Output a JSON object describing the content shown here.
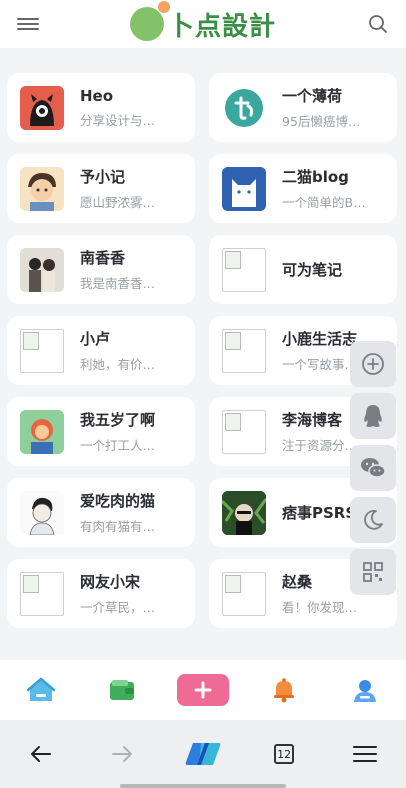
{
  "header": {
    "logo_text": "卜点設計",
    "menu_icon": "hamburger-icon",
    "search_icon": "search-icon"
  },
  "cards": [
    {
      "title": "Heo",
      "desc": "分享设计与…",
      "avatar": "red-monster"
    },
    {
      "title": "一个薄荷",
      "desc": "95后懒癌博…",
      "avatar": "teal-letter"
    },
    {
      "title": "予小记",
      "desc": "愿山野浓雾…",
      "avatar": "cartoon-boy"
    },
    {
      "title": "二猫blog",
      "desc": "一个简单的B…",
      "avatar": "blue-cat"
    },
    {
      "title": "南香香",
      "desc": "我是南香香…",
      "avatar": "photo-couple"
    },
    {
      "title": "可为笔记",
      "desc": "",
      "avatar": "broken"
    },
    {
      "title": "小卢",
      "desc": "利她，有价…",
      "avatar": "broken"
    },
    {
      "title": "小鹿生活志",
      "desc": "一个写故事…",
      "avatar": "broken"
    },
    {
      "title": "我五岁了啊",
      "desc": "一个打工人…",
      "avatar": "colorful-kid"
    },
    {
      "title": "李海博客",
      "desc": "注于资源分…",
      "avatar": "broken"
    },
    {
      "title": "爱吃肉的猫",
      "desc": "有肉有猫有…",
      "avatar": "sketch-boy"
    },
    {
      "title": "痞事PSRS",
      "desc": "",
      "avatar": "dog-plants"
    },
    {
      "title": "网友小宋",
      "desc": "一介草民，…",
      "avatar": "broken"
    },
    {
      "title": "赵桑",
      "desc": "看！你发现…",
      "avatar": "broken"
    }
  ],
  "side_tools": [
    "plus-circle-icon",
    "qq-icon",
    "wechat-icon",
    "moon-icon",
    "qr-code-icon"
  ],
  "bottom_nav": [
    "home-icon",
    "wallet-icon",
    "add-icon",
    "bell-icon",
    "user-icon"
  ],
  "browser": {
    "tab_count": "12",
    "colors": {
      "accent_pink": "#f06a96",
      "brand_green": "#3a8f45"
    }
  }
}
